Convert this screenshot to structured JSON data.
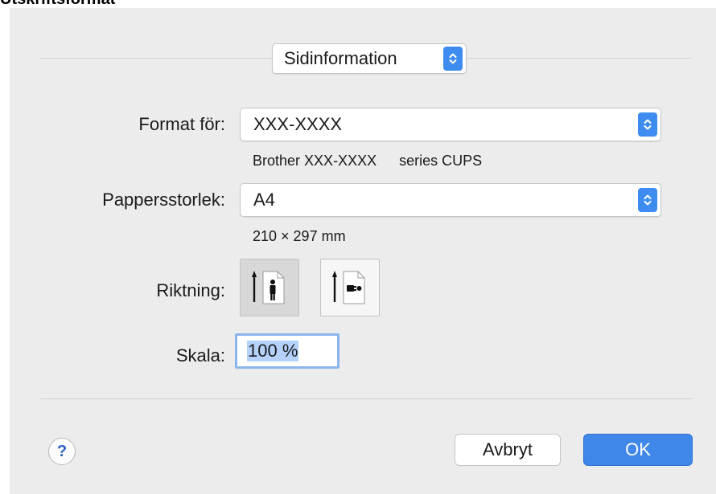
{
  "page_heading": "Utskriftsformat",
  "section_selector": {
    "value": "Sidinformation",
    "icon": "stepper-chevrons-icon"
  },
  "format_for": {
    "label": "Format för:",
    "value": "XXX-XXXX",
    "description_brand": "Brother",
    "description_model": "XXX-XXXX",
    "description_suffix": "series CUPS"
  },
  "paper_size": {
    "label": "Pappersstorlek:",
    "value": "A4",
    "dimensions": "210 × 297 mm"
  },
  "orientation": {
    "label": "Riktning:",
    "options": [
      "portrait-orientation-icon",
      "landscape-orientation-icon"
    ],
    "selected": 0
  },
  "scale": {
    "label": "Skala:",
    "value": "100 %"
  },
  "buttons": {
    "help": "?",
    "cancel": "Avbryt",
    "ok": "OK"
  },
  "colors": {
    "accent": "#3f87e8",
    "dialog_bg": "#ececec",
    "selection": "#b4d2fb"
  }
}
